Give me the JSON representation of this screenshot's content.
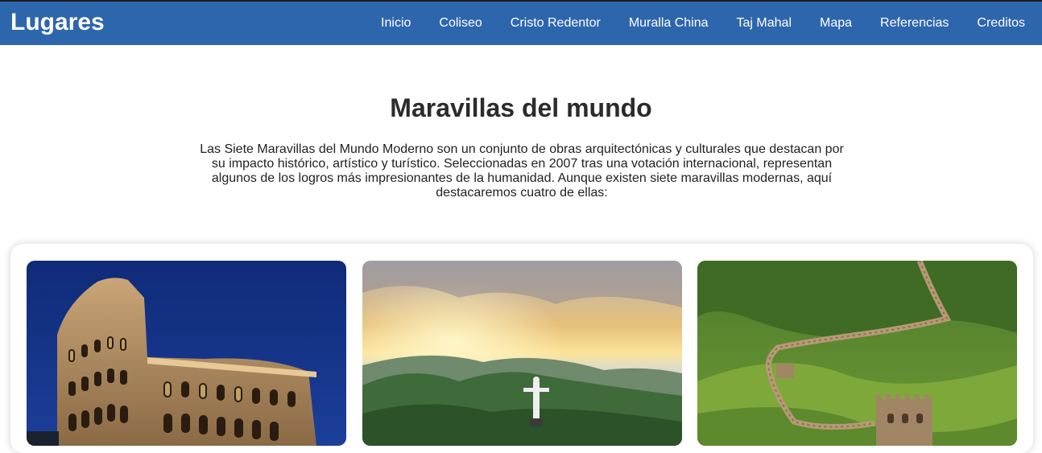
{
  "header": {
    "brand": "Lugares",
    "nav": [
      "Inicio",
      "Coliseo",
      "Cristo Redentor",
      "Muralla China",
      "Taj Mahal",
      "Mapa",
      "Referencias",
      "Creditos"
    ]
  },
  "main": {
    "title": "Maravillas del mundo",
    "intro": "Las Siete Maravillas del Mundo Moderno son un conjunto de obras arquitectónicas y culturales que destacan por su impacto histórico, artístico y turístico. Seleccionadas en 2007 tras una votación internacional, representan algunos de los logros más impresionantes de la humanidad. Aunque existen siete maravillas modernas, aquí destacaremos cuatro de ellas:"
  },
  "colors": {
    "header_bg": "#2e66ad",
    "header_text": "#ffffff"
  }
}
